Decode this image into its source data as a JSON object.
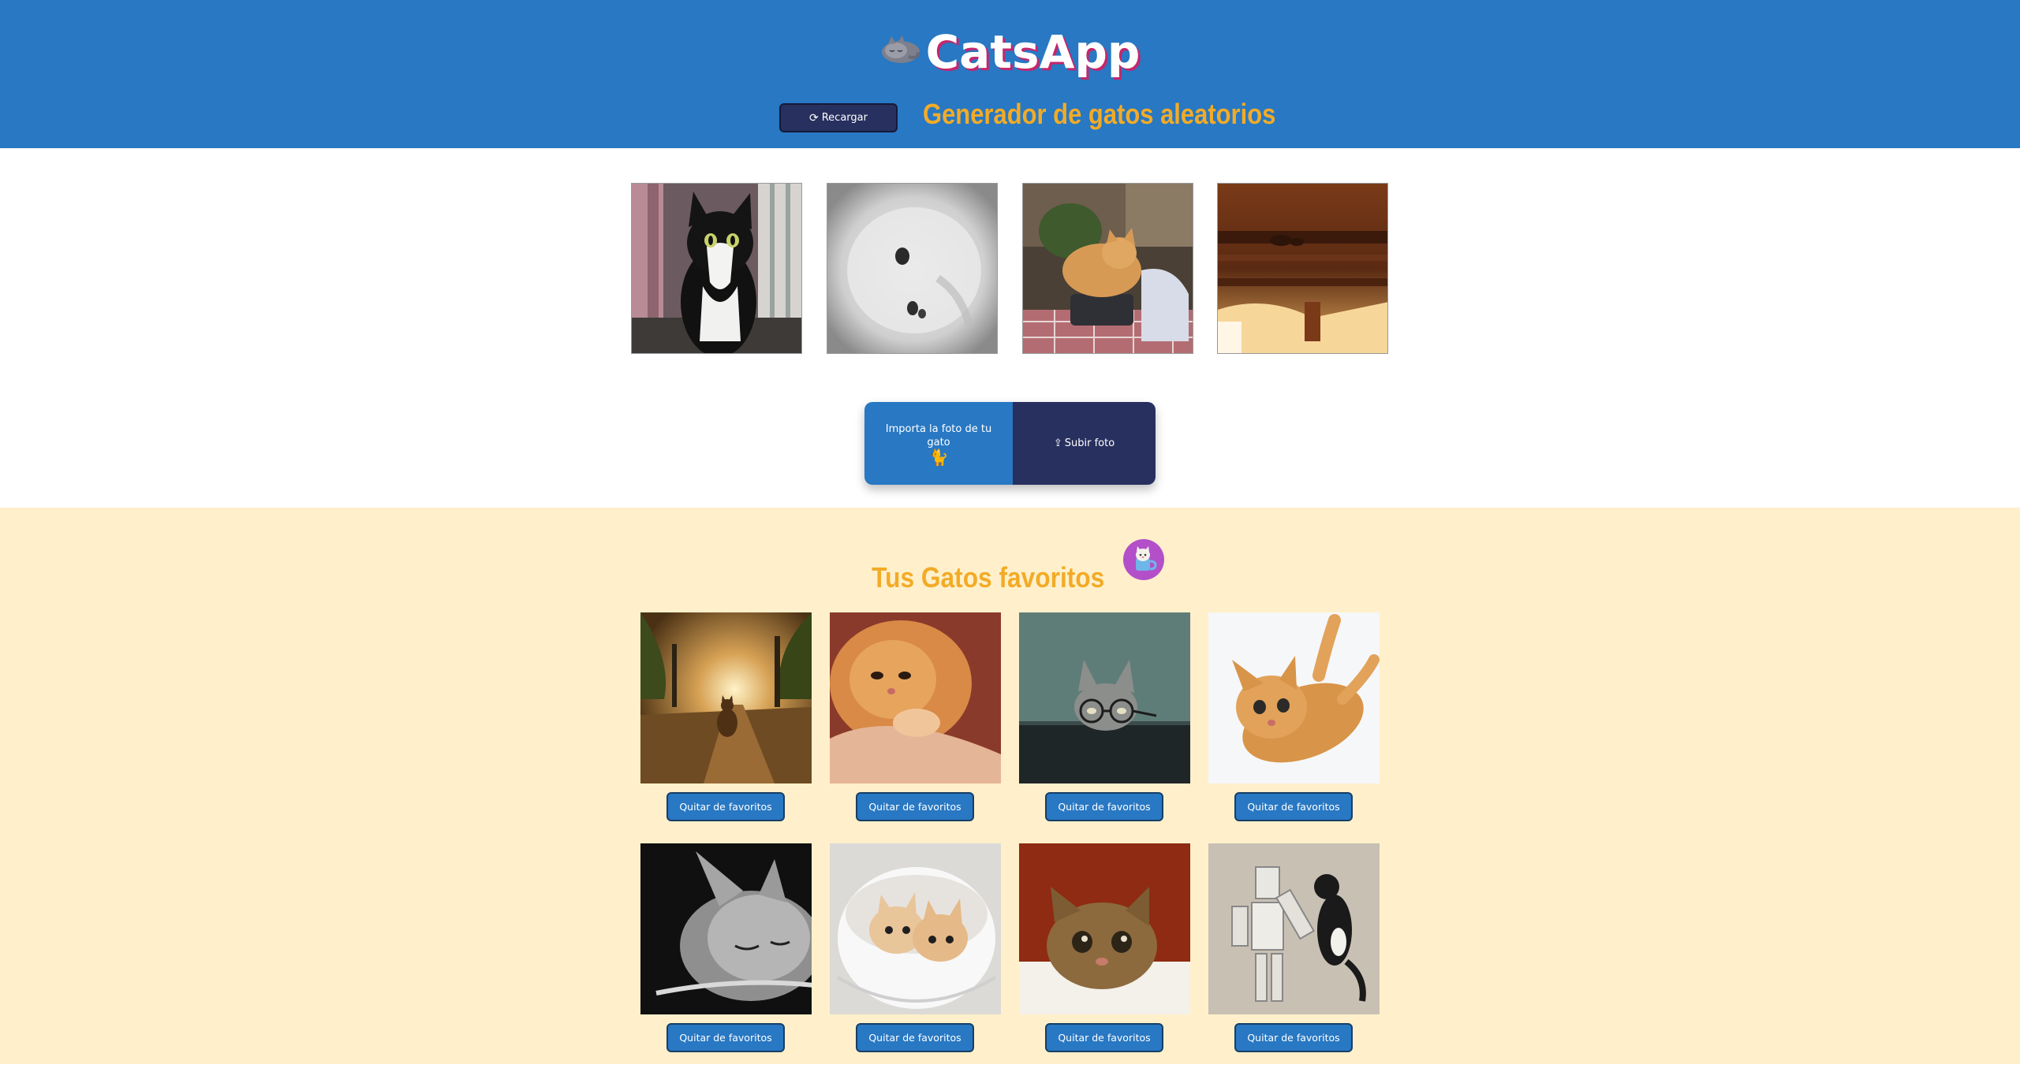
{
  "header": {
    "title": "CatsApp",
    "subtitle": "Generador de gatos aleatorios",
    "reload_label": "Recargar",
    "reload_icon": "refresh-icon",
    "logo_icon": "sleeping-cat-logo"
  },
  "random_cats": [
    {
      "description_icon": "cat-photo-tuxedo"
    },
    {
      "description_icon": "cat-photo-white-blur"
    },
    {
      "description_icon": "cat-photo-orange-on-laundry"
    },
    {
      "description_icon": "cat-photo-under-table"
    }
  ],
  "upload": {
    "prompt": "Importa la foto de tu gato",
    "prompt_icon": "cat-icon",
    "button_label": "Subir foto",
    "button_icon": "file-upload-icon"
  },
  "favorites": {
    "title": "Tus Gatos favoritos",
    "badge_icon": "cat-mug-icon",
    "items": [
      {
        "remove_label": "Quitar de favoritos"
      },
      {
        "remove_label": "Quitar de favoritos"
      },
      {
        "remove_label": "Quitar de favoritos"
      },
      {
        "remove_label": "Quitar de favoritos"
      },
      {
        "remove_label": "Quitar de favoritos"
      },
      {
        "remove_label": "Quitar de favoritos"
      },
      {
        "remove_label": "Quitar de favoritos"
      },
      {
        "remove_label": "Quitar de favoritos"
      }
    ]
  },
  "colors": {
    "header_bg": "#2878c3",
    "accent_yellow": "#f2ab27",
    "navy": "#28305f",
    "favorites_bg": "#fff0cb",
    "title_shadow": "#c3276c"
  }
}
